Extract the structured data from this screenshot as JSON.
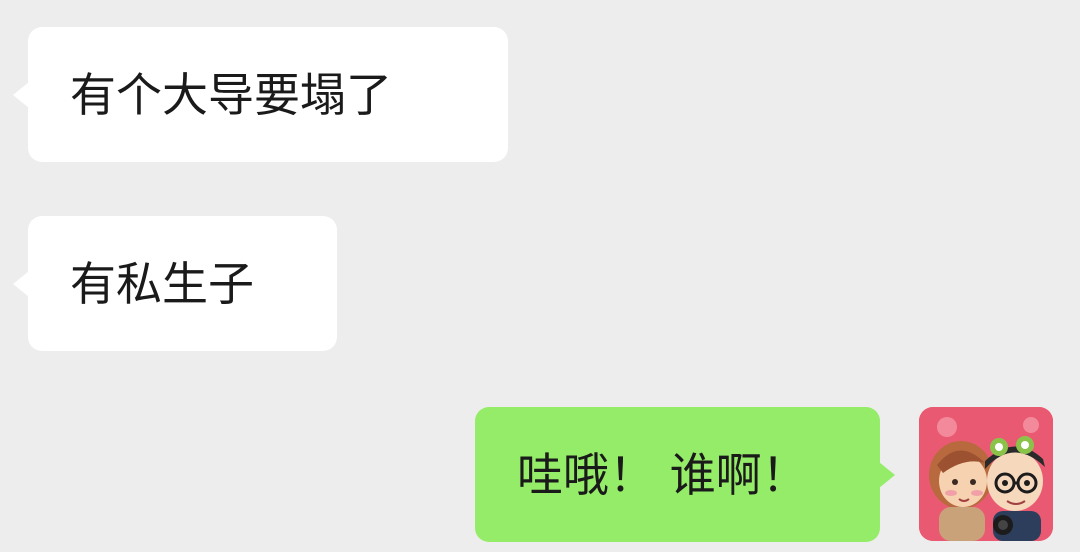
{
  "messages": [
    {
      "direction": "incoming",
      "text": "有个大导要塌了"
    },
    {
      "direction": "incoming",
      "text": "有私生子"
    },
    {
      "direction": "outgoing",
      "text": "哇哦！ 谁啊！"
    }
  ],
  "colors": {
    "background": "#ededed",
    "incoming_bubble": "#ffffff",
    "outgoing_bubble": "#95ec69",
    "text": "#1a1a1a",
    "avatar_background": "#e95a72"
  },
  "avatar": {
    "icon": "couple-cartoon-avatar-icon"
  }
}
